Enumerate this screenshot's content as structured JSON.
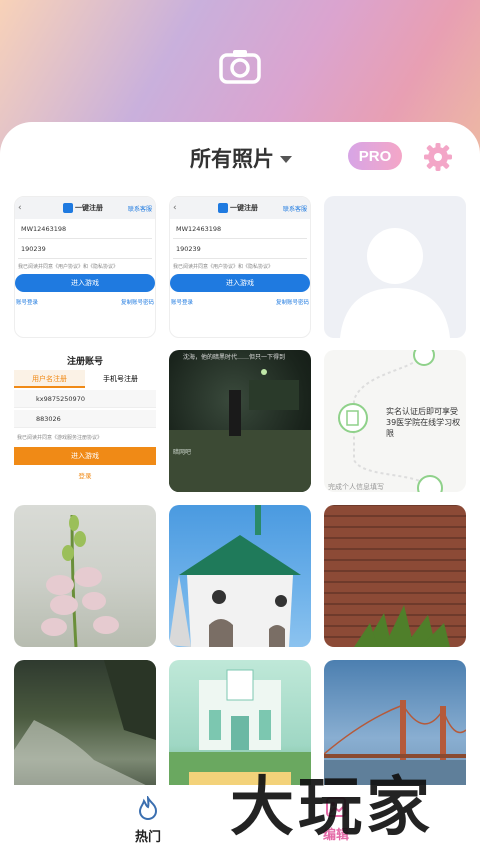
{
  "header": {
    "title": "所有照片",
    "pro_label": "PRO"
  },
  "icons": {
    "camera": "camera-icon",
    "gear": "gear-icon",
    "fire": "fire-icon",
    "edit": "edit-icon"
  },
  "colors": {
    "accent": "#f4a6c7",
    "brand_blue": "#1f7ae0",
    "orange": "#f08a16"
  },
  "tiles": {
    "shot1": {
      "bar_title": "一键注册",
      "service": "联系客服",
      "user": "MW12463198",
      "pwd": "190239",
      "agree": "我已阅读并同意《用户协议》和《隐私协议》",
      "button": "进入游戏",
      "link_left": "账号登录",
      "link_right": "复制账号密码"
    },
    "shot2": {
      "bar_title": "一键注册",
      "service": "联系客服",
      "user": "MW12463198",
      "pwd": "190239",
      "agree": "我已阅读并同意《用户协议》和《隐私协议》",
      "button": "进入游戏",
      "link_left": "账号登录",
      "link_right": "复制账号密码"
    },
    "reg": {
      "title": "注册账号",
      "tab1": "用户名注册",
      "tab2": "手机号注册",
      "user": "kx9875250970",
      "pwd": "883026",
      "agree": "我已阅读并同意《游戏服务注册协议》",
      "button": "进入游戏",
      "login": "登录"
    },
    "night": {
      "top_text": "沈海，他的暗黑时代……但只一下得到",
      "caption": "暗网吧"
    },
    "flow": {
      "text_line1": "实名认证后即可享受",
      "text_line2": "39医学院在线学习权限",
      "bottom": "完成个人信息填写"
    }
  },
  "nav": {
    "hot": "热门",
    "edit": "编辑"
  },
  "watermark": "大玩家"
}
